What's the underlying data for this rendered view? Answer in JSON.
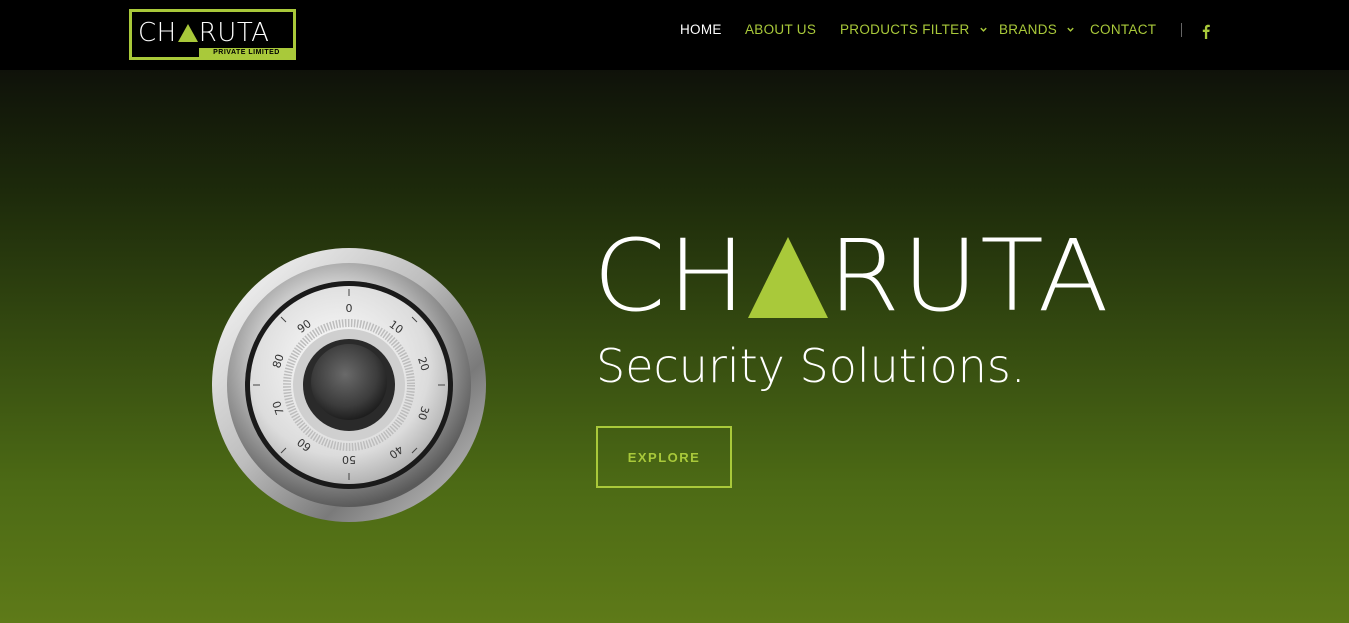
{
  "brand": {
    "logo_main_left": "CH",
    "logo_main_right": "RUTA",
    "logo_sub": "PRIVATE LIMITED",
    "accent_color": "#a9c93a"
  },
  "nav": {
    "items": [
      {
        "label": "HOME",
        "active": true
      },
      {
        "label": "ABOUT US",
        "active": false
      },
      {
        "label": "PRODUCTS FILTER",
        "active": false,
        "dropdown": true
      },
      {
        "label": "BRANDS",
        "active": false,
        "dropdown": true
      },
      {
        "label": "CONTACT",
        "active": false
      }
    ],
    "social_icon": "facebook-icon"
  },
  "hero": {
    "title_left": "CH",
    "title_right": "RUTA",
    "tagline": "Security Solutions.",
    "cta_label": "EXPLORE",
    "dial_numbers": [
      "0",
      "10",
      "20",
      "30",
      "40",
      "50",
      "60",
      "70",
      "80",
      "90"
    ]
  }
}
